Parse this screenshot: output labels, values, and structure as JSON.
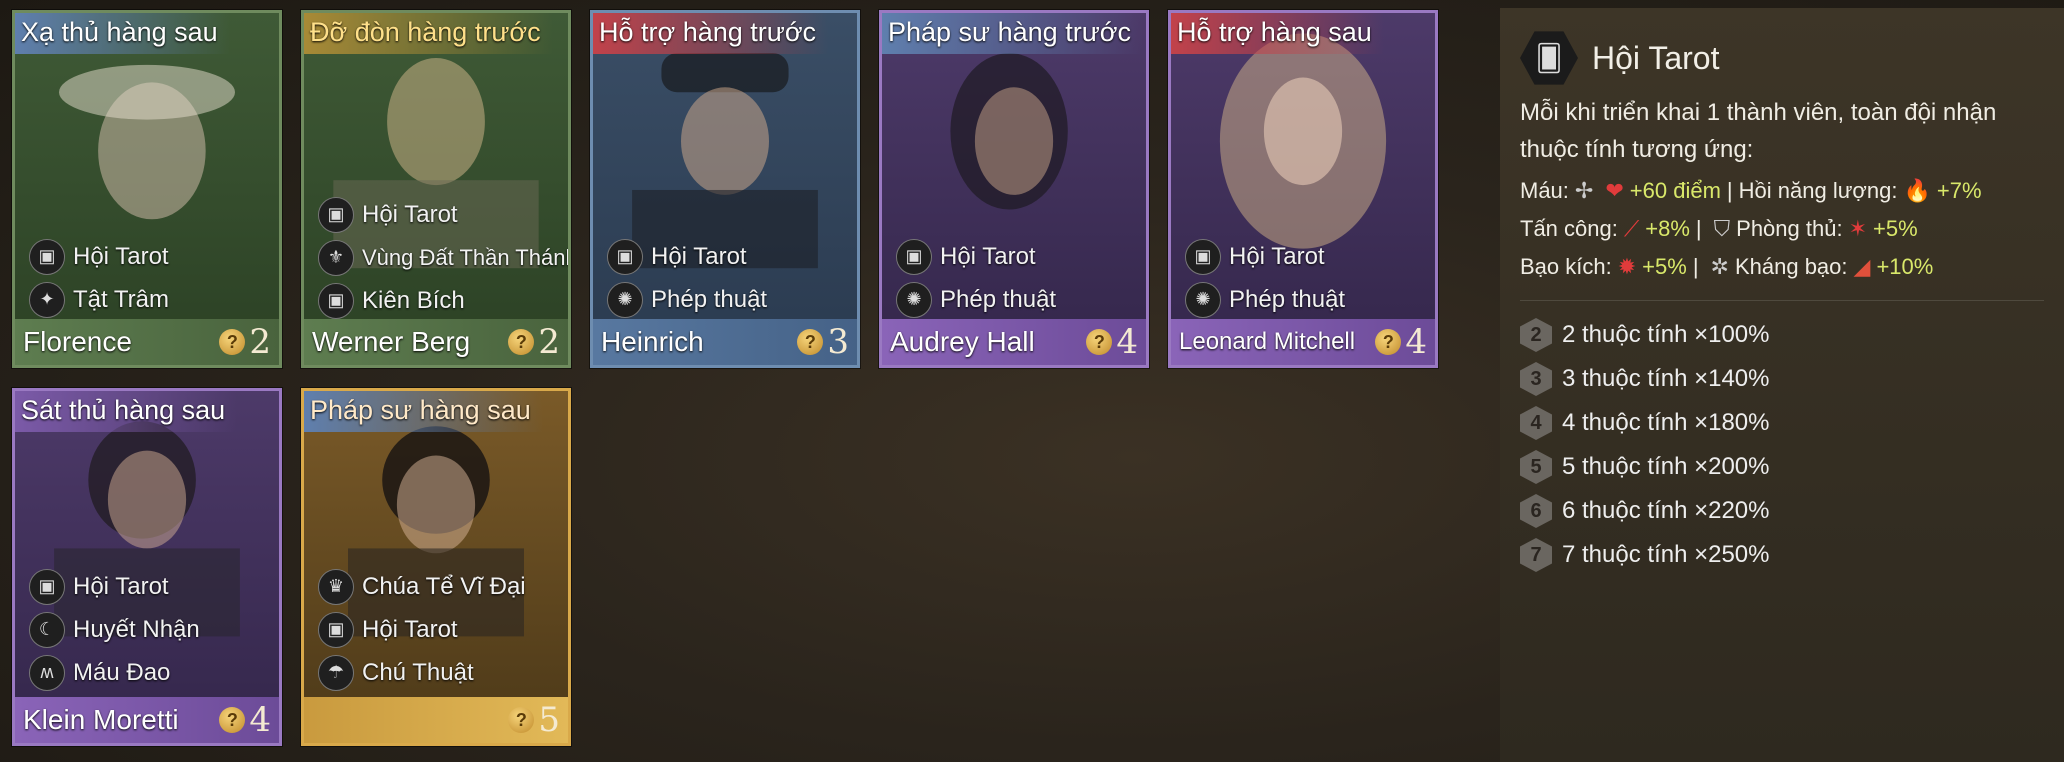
{
  "cards": [
    {
      "role": "Xạ thủ hàng sau",
      "name": "Florence",
      "cost": "2",
      "traits": [
        "Hội Tarot",
        "Tật Trâm"
      ]
    },
    {
      "role": "Đỡ đòn hàng trước",
      "name": "Werner Berg",
      "cost": "2",
      "traits": [
        "Hội Tarot",
        "Vùng Đất Thần Thánh",
        "Kiên Bích"
      ]
    },
    {
      "role": "Hỗ trợ hàng trước",
      "name": "Heinrich",
      "cost": "3",
      "traits": [
        "Hội Tarot",
        "Phép thuật"
      ]
    },
    {
      "role": "Pháp sư hàng trước",
      "name": "Audrey Hall",
      "cost": "4",
      "traits": [
        "Hội Tarot",
        "Phép thuật"
      ]
    },
    {
      "role": "Hỗ trợ hàng sau",
      "name": "Leonard Mitchell",
      "cost": "4",
      "traits": [
        "Hội Tarot",
        "Phép thuật"
      ]
    },
    {
      "role": "Sát thủ hàng sau",
      "name": "Klein Moretti",
      "cost": "4",
      "traits": [
        "Hội Tarot",
        "Huyết Nhận",
        "Máu Đao"
      ]
    },
    {
      "role": "Pháp sư hàng sau",
      "name": "",
      "cost": "5",
      "traits": [
        "Chúa Tể Vĩ Đại",
        "Hội Tarot",
        "Chú Thuật"
      ]
    }
  ],
  "panel": {
    "title": "Hội Tarot",
    "desc": "Mỗi khi triển khai 1 thành viên, toàn đội nhận thuộc tính tương ứng:",
    "stats": [
      {
        "label": "Máu:",
        "value": "+60 điểm",
        "sep": "|",
        "label2": "Hồi năng lượng:",
        "value2": "+7%"
      },
      {
        "label": "Tấn công:",
        "value": "+8%",
        "sep": "|",
        "label2": "Phòng thủ:",
        "value2": "+5%"
      },
      {
        "label": "Bạo kích:",
        "value": "+5%",
        "sep": "|",
        "label2": "Kháng bạo:",
        "value2": "+10%"
      }
    ],
    "tiers": [
      {
        "n": "2",
        "text": "2 thuộc tính ×100%"
      },
      {
        "n": "3",
        "text": "3 thuộc tính ×140%"
      },
      {
        "n": "4",
        "text": "4 thuộc tính ×180%"
      },
      {
        "n": "5",
        "text": "5 thuộc tính ×200%"
      },
      {
        "n": "6",
        "text": "6 thuộc tính ×220%"
      },
      {
        "n": "7",
        "text": "7 thuộc tính ×250%"
      }
    ]
  },
  "colors": {
    "accent_green": "#d9e86a",
    "gold": "#d9a94a",
    "purple": "#9a79c2"
  }
}
